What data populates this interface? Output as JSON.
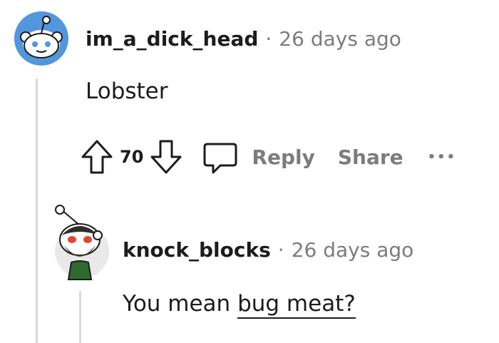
{
  "comment": {
    "author": "im_a_dick_head",
    "separator": "·",
    "time": "26 days ago",
    "body": "Lobster",
    "votes": "70",
    "actions": {
      "reply": "Reply",
      "share": "Share",
      "more": "•••"
    },
    "avatar_icon": "snoo-avatar-icon"
  },
  "reply": {
    "author": "knock_blocks",
    "separator": "·",
    "time": "26 days ago",
    "body_prefix": "You mean ",
    "body_link": "bug meat?",
    "avatar_icon": "snoo-avatar-icon"
  },
  "colors": {
    "text": "#1c1c1c",
    "muted": "#7c7c7c",
    "thread_line": "#dadada",
    "avatar_blue": "#5296dd"
  }
}
